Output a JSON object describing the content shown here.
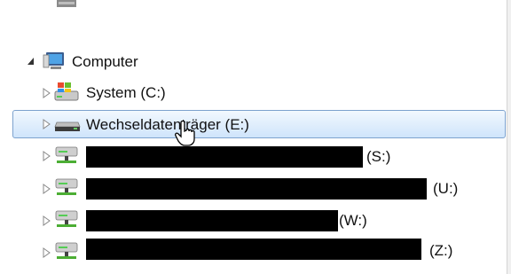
{
  "tree": {
    "computer": {
      "label": "Computer",
      "icon": "computer-icon"
    },
    "items": [
      {
        "label": "System (C:)",
        "icon": "windows-drive-icon"
      },
      {
        "label": "Wechseldatenträger (E:)",
        "icon": "removable-drive-icon",
        "selected": true
      },
      {
        "label": "(S:)",
        "icon": "network-drive-icon",
        "redacted": true
      },
      {
        "label": "(U:)",
        "icon": "network-drive-icon",
        "redacted": true
      },
      {
        "label": "(W:)",
        "icon": "network-drive-icon",
        "redacted": true
      },
      {
        "label": "(Z:)",
        "icon": "network-drive-icon",
        "redacted": true
      }
    ]
  },
  "colors": {
    "selection_border": "#7da2ce",
    "selection_fill": "#cfe4fb",
    "redaction": "#000000"
  }
}
